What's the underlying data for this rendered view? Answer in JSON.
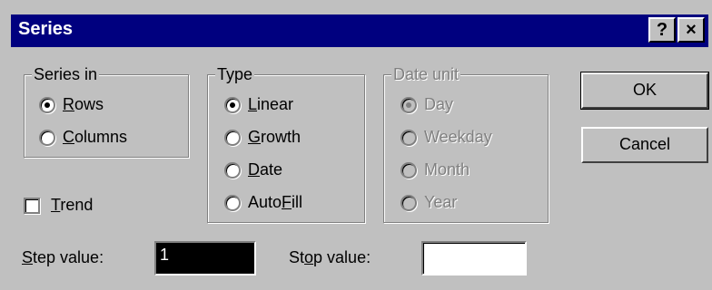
{
  "window": {
    "title": "Series"
  },
  "titlebar": {
    "help_label": "?",
    "close_label": "×"
  },
  "series_in": {
    "legend": "Series in",
    "options": [
      {
        "label": "Rows",
        "mnemonic": "R",
        "rest": "ows",
        "selected": true
      },
      {
        "label": "Columns",
        "mnemonic": "C",
        "rest": "olumns",
        "selected": false
      }
    ]
  },
  "type": {
    "legend": "Type",
    "options": [
      {
        "label": "Linear",
        "pre": "",
        "mnemonic": "L",
        "rest": "inear",
        "selected": true
      },
      {
        "label": "Growth",
        "pre": "",
        "mnemonic": "G",
        "rest": "rowth",
        "selected": false
      },
      {
        "label": "Date",
        "pre": "",
        "mnemonic": "D",
        "rest": "ate",
        "selected": false
      },
      {
        "label": "AutoFill",
        "pre": "Auto",
        "mnemonic": "F",
        "rest": "ill",
        "selected": false
      }
    ]
  },
  "date_unit": {
    "legend": "Date unit",
    "options": [
      {
        "label": "Day",
        "selected": true
      },
      {
        "label": "Weekday",
        "selected": false
      },
      {
        "label": "Month",
        "selected": false
      },
      {
        "label": "Year",
        "selected": false
      }
    ]
  },
  "trend": {
    "mnemonic": "T",
    "rest": "rend",
    "checked": false
  },
  "step": {
    "mnemonic": "S",
    "rest": "tep value:",
    "value": "1"
  },
  "stop": {
    "pre": "St",
    "mnemonic": "o",
    "rest": "p value:",
    "value": ""
  },
  "buttons": {
    "ok": "OK",
    "cancel": "Cancel"
  }
}
